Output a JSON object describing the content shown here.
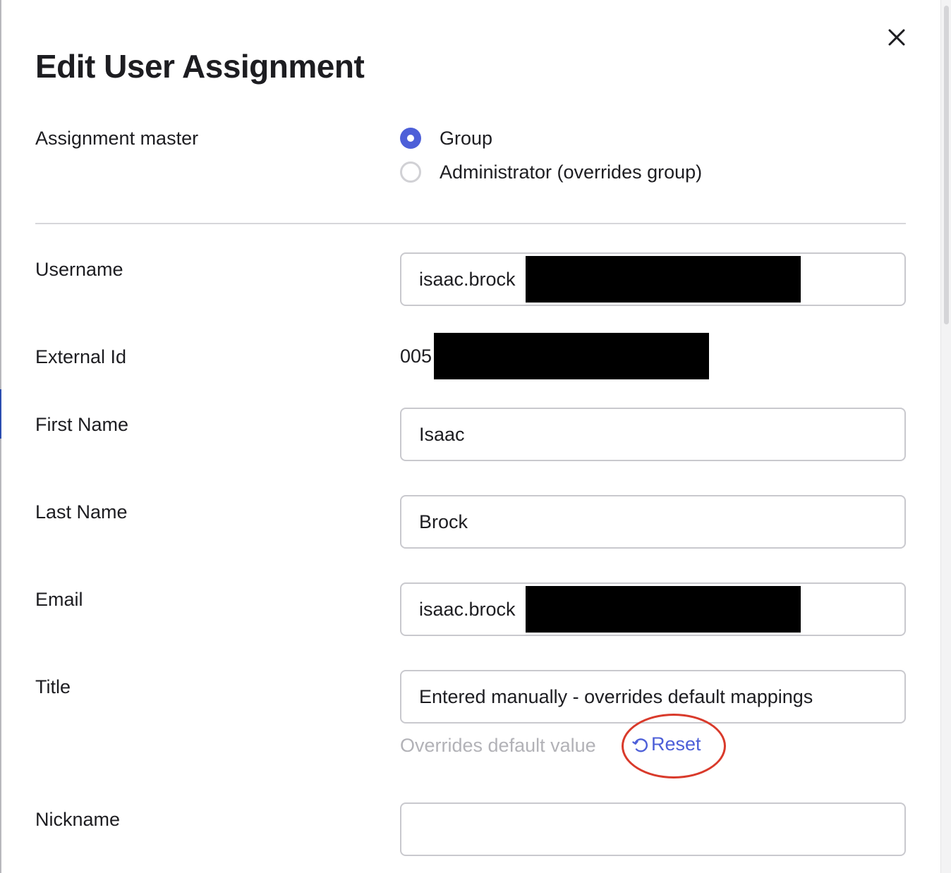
{
  "modal": {
    "title": "Edit User Assignment",
    "close_icon": "close-icon"
  },
  "assignment_master": {
    "label": "Assignment master",
    "options": [
      {
        "label": "Group",
        "selected": true
      },
      {
        "label": "Administrator (overrides group)",
        "selected": false
      }
    ]
  },
  "fields": {
    "username": {
      "label": "Username",
      "value": "isaac.brock"
    },
    "external_id": {
      "label": "External Id",
      "value": "005"
    },
    "first_name": {
      "label": "First Name",
      "value": "Isaac"
    },
    "last_name": {
      "label": "Last Name",
      "value": "Brock"
    },
    "email": {
      "label": "Email",
      "value": "isaac.brock"
    },
    "title": {
      "label": "Title",
      "value": "Entered manually - overrides default mappings",
      "hint": "Overrides default value",
      "reset_label": "Reset",
      "reset_icon": "reset-icon"
    },
    "nickname": {
      "label": "Nickname",
      "value": ""
    }
  },
  "colors": {
    "accent": "#4d5fd8",
    "annotation": "#d93a2b",
    "text": "#1d1d21",
    "hint": "#b2b2b7"
  }
}
